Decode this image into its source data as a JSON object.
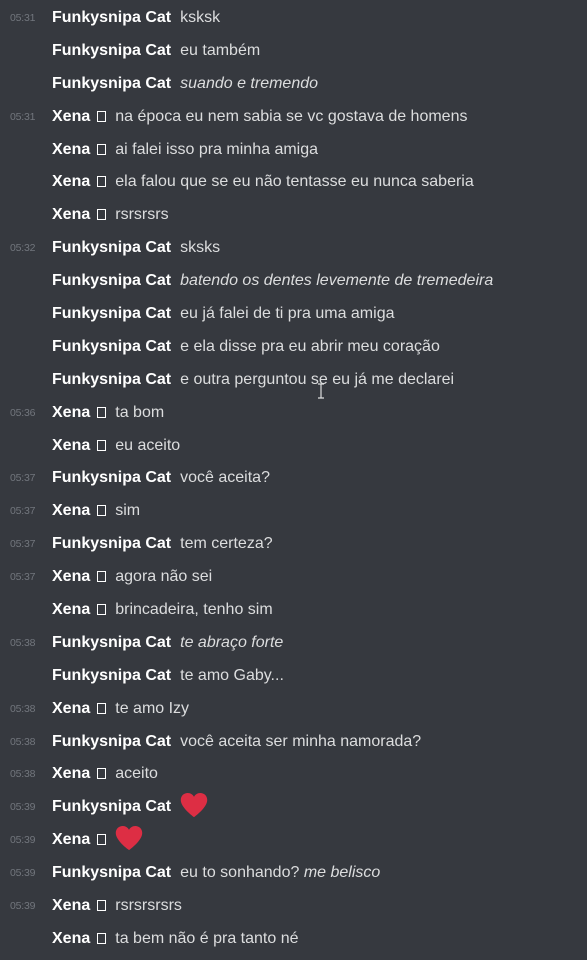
{
  "messages": [
    {
      "time": "05:31",
      "author": "Funkysnipa Cat",
      "box": false,
      "text": "ksksk"
    },
    {
      "time": "",
      "author": "Funkysnipa Cat",
      "box": false,
      "text": "eu também"
    },
    {
      "time": "",
      "author": "Funkysnipa Cat",
      "box": false,
      "text": "suando e tremendo",
      "italic": true
    },
    {
      "time": "05:31",
      "author": "Xena",
      "box": true,
      "text": "na época eu nem sabia se vc gostava de homens"
    },
    {
      "time": "",
      "author": "Xena",
      "box": true,
      "text": "ai falei isso pra minha amiga"
    },
    {
      "time": "",
      "author": "Xena",
      "box": true,
      "text": "ela falou que se eu não tentasse eu nunca saberia"
    },
    {
      "time": "",
      "author": "Xena",
      "box": true,
      "text": "rsrsrsrs"
    },
    {
      "time": "05:32",
      "author": "Funkysnipa Cat",
      "box": false,
      "text": "sksks"
    },
    {
      "time": "",
      "author": "Funkysnipa Cat",
      "box": false,
      "text": "batendo os dentes levemente de tremedeira",
      "italic": true
    },
    {
      "time": "",
      "author": "Funkysnipa Cat",
      "box": false,
      "text": "eu já falei de ti pra uma amiga"
    },
    {
      "time": "",
      "author": "Funkysnipa Cat",
      "box": false,
      "text": "e ela disse pra eu abrir meu coração"
    },
    {
      "time": "",
      "author": "Funkysnipa Cat",
      "box": false,
      "text": "e outra perguntou se eu já me declarei"
    },
    {
      "time": "05:36",
      "author": "Xena",
      "box": true,
      "text": "ta bom"
    },
    {
      "time": "",
      "author": "Xena",
      "box": true,
      "text": "eu aceito"
    },
    {
      "time": "05:37",
      "author": "Funkysnipa Cat",
      "box": false,
      "text": "você aceita?"
    },
    {
      "time": "05:37",
      "author": "Xena",
      "box": true,
      "text": "sim"
    },
    {
      "time": "05:37",
      "author": "Funkysnipa Cat",
      "box": false,
      "text": "tem certeza?"
    },
    {
      "time": "05:37",
      "author": "Xena",
      "box": true,
      "text": "agora não sei"
    },
    {
      "time": "",
      "author": "Xena",
      "box": true,
      "text": "brincadeira, tenho sim"
    },
    {
      "time": "05:38",
      "author": "Funkysnipa Cat",
      "box": false,
      "text": "te abraço forte",
      "italic": true
    },
    {
      "time": "",
      "author": "Funkysnipa Cat",
      "box": false,
      "text": "te amo Gaby..."
    },
    {
      "time": "05:38",
      "author": "Xena",
      "box": true,
      "text": "te amo Izy"
    },
    {
      "time": "05:38",
      "author": "Funkysnipa Cat",
      "box": false,
      "text": "você aceita ser minha namorada?"
    },
    {
      "time": "05:38",
      "author": "Xena",
      "box": true,
      "text": "aceito"
    },
    {
      "time": "05:39",
      "author": "Funkysnipa Cat",
      "box": false,
      "text": "",
      "emoji": "heart-icon"
    },
    {
      "time": "05:39",
      "author": "Xena",
      "box": true,
      "text": "",
      "emoji": "heart-icon"
    },
    {
      "time": "05:39",
      "author": "Funkysnipa Cat",
      "box": false,
      "text": "eu to sonhando?",
      "text_italic_suffix": "me belisco"
    },
    {
      "time": "05:39",
      "author": "Xena",
      "box": true,
      "text": "rsrsrsrsrs"
    },
    {
      "time": "",
      "author": "Xena",
      "box": true,
      "text": "ta bem não é pra tanto né"
    }
  ],
  "colors": {
    "background": "#36393f",
    "author": "#ffffff",
    "text": "#dcddde",
    "timestamp": "#72767d",
    "heart": "#dd2e44"
  }
}
